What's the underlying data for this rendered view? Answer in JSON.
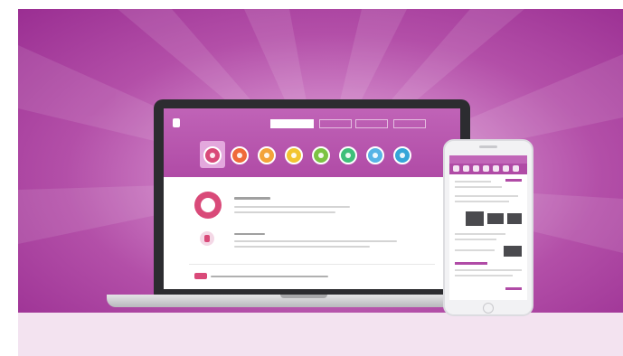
{
  "colors": {
    "background_purple": "#b34fa8",
    "accent_magenta": "#b04ba6",
    "step_colors": [
      "#d94a79",
      "#ef6a3a",
      "#f3a33a",
      "#f2c531",
      "#7cc343",
      "#3fbf7a",
      "#58b4e6",
      "#36a6d8"
    ],
    "highlight_pink": "#d94a79"
  },
  "icons": {
    "steps": [
      "target-icon",
      "warning-icon",
      "price-tag-icon",
      "lightbulb-icon",
      "check-icon",
      "leaf-icon",
      "water-drop-icon",
      "info-icon"
    ],
    "detail": "phone-icon",
    "promo": "card-icon"
  },
  "laptop": {
    "nav_count": 4,
    "step_count": 8
  },
  "phone": {
    "step_count": 7
  },
  "credit": ""
}
